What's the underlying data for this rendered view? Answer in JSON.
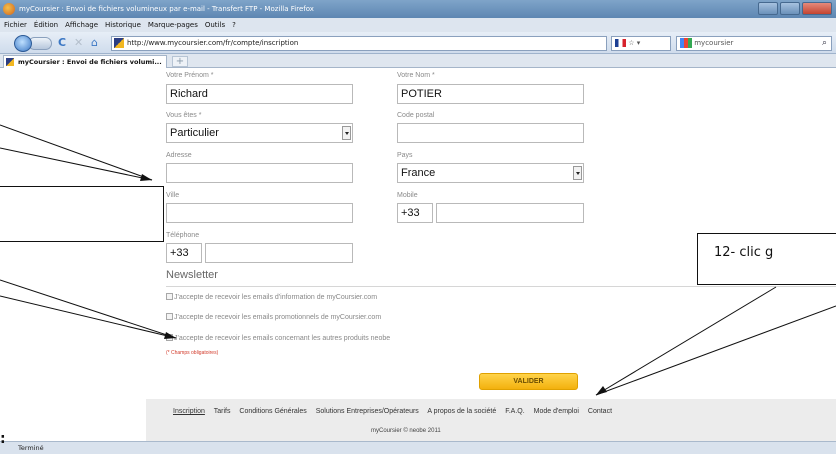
{
  "browser": {
    "window_title": "myCoursier : Envoi de fichiers volumineux par e-mail - Transfert FTP - Mozilla Firefox",
    "menu": [
      "Fichier",
      "Édition",
      "Affichage",
      "Historique",
      "Marque-pages",
      "Outils",
      "?"
    ],
    "url": "http://www.mycoursier.com/fr/compte/inscription",
    "search_value": "mycoursier",
    "tab_title": "myCoursier : Envoi de fichiers volumi...",
    "new_tab_symbol": "+",
    "status": "Terminé"
  },
  "form": {
    "prenom_label": "Votre Prénom *",
    "prenom_value": "Richard",
    "nom_label": "Votre Nom *",
    "nom_value": "POTIER",
    "vous_etes_label": "Vous êtes *",
    "vous_etes_value": "Particulier",
    "code_postal_label": "Code postal",
    "code_postal_value": "",
    "adresse_label": "Adresse",
    "adresse_value": "",
    "pays_label": "Pays",
    "pays_value": "France",
    "ville_label": "Ville",
    "ville_value": "",
    "mobile_label": "Mobile",
    "mobile_prefix": "+33",
    "mobile_value": "",
    "telephone_label": "Téléphone",
    "telephone_prefix": "+33",
    "telephone_value": ""
  },
  "newsletter": {
    "title": "Newsletter",
    "options": [
      "J'accepte de recevoir les emails d'information de myCoursier.com",
      "J'accepte de recevoir les emails promotionnels de myCoursier.com",
      "J'accepte de recevoir les emails concernant les autres produits neobe"
    ],
    "required_note": "(* Champs obligatoires)",
    "submit_label": "VALIDER"
  },
  "footer": {
    "links": [
      "Inscription",
      "Tarifs",
      "Conditions Générales",
      "Solutions Entreprises/Opérateurs",
      "A propos de la société",
      "F.A.Q.",
      "Mode d'emploi",
      "Contact"
    ],
    "copyright": "myCoursier © neobe 2011"
  },
  "annotations": {
    "callout_right_text": "12- clic g",
    "bottom_left_mark": ":"
  }
}
